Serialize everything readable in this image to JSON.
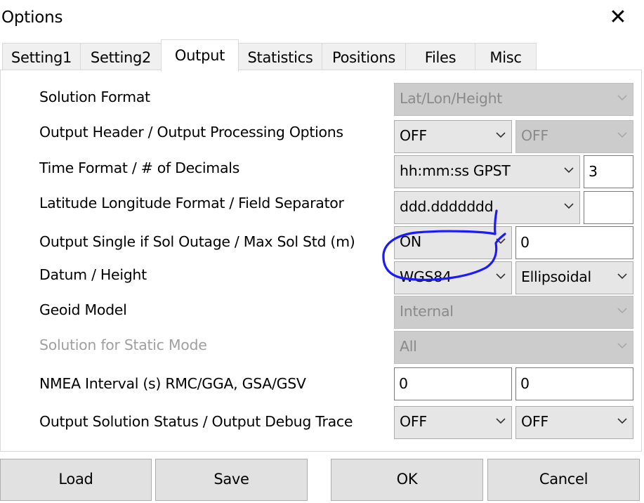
{
  "window": {
    "title": "Options",
    "close_glyph": "✕"
  },
  "tabs": [
    {
      "label": "Setting1"
    },
    {
      "label": "Setting2"
    },
    {
      "label": "Output",
      "active": true
    },
    {
      "label": "Statistics"
    },
    {
      "label": "Positions"
    },
    {
      "label": "Files"
    },
    {
      "label": "Misc"
    }
  ],
  "rows": {
    "solution_format": {
      "label": "Solution Format",
      "value": "Lat/Lon/Height"
    },
    "output_header": {
      "label": "Output Header / Output Processing Options",
      "value1": "OFF",
      "value2": "OFF"
    },
    "time_format": {
      "label": "Time Format / # of Decimals",
      "value": "hh:mm:ss GPST",
      "decimals": "3"
    },
    "lat_lon_format": {
      "label": "Latitude Longitude Format / Field Separator",
      "value": "ddd.ddddddd",
      "separator": ""
    },
    "output_single": {
      "label": "Output Single if Sol Outage / Max Sol Std (m)",
      "value": "ON",
      "max_std": "0"
    },
    "datum_height": {
      "label": "Datum / Height",
      "datum": "WGS84",
      "height": "Ellipsoidal"
    },
    "geoid_model": {
      "label": "Geoid Model",
      "value": "Internal"
    },
    "static_mode": {
      "label": "Solution for Static Mode",
      "value": "All"
    },
    "nmea_interval": {
      "label": "NMEA Interval (s) RMC/GGA, GSA/GSV",
      "value1": "0",
      "value2": "0"
    },
    "solution_status": {
      "label": "Output Solution Status / Output Debug Trace",
      "value1": "OFF",
      "value2": "OFF"
    }
  },
  "buttons": {
    "load": "Load",
    "save": "Save",
    "ok": "OK",
    "cancel": "Cancel"
  },
  "colors": {
    "annotation": "#1a1aff",
    "disabled_field": "#cccccc",
    "combo_bg": "#e6e6e6",
    "button_bg": "#e1e1e1"
  },
  "icons": {
    "close": "close-icon",
    "dropdown": "chevron-down-icon"
  }
}
